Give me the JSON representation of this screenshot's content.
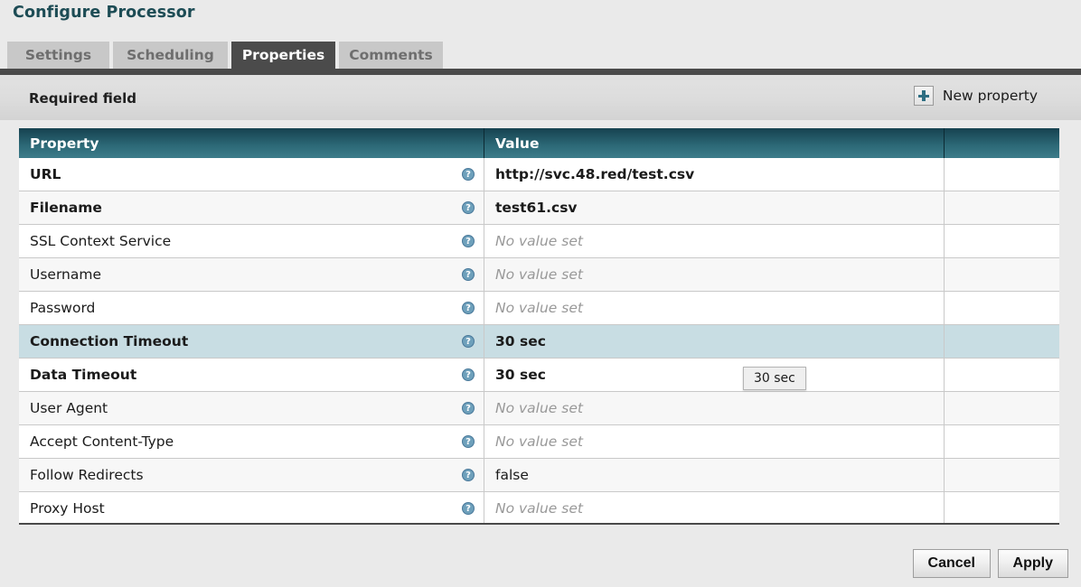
{
  "dialog": {
    "title": "Configure Processor"
  },
  "tabs": [
    {
      "label": "Settings",
      "active": false
    },
    {
      "label": "Scheduling",
      "active": false
    },
    {
      "label": "Properties",
      "active": true
    },
    {
      "label": "Comments",
      "active": false
    }
  ],
  "toolbar": {
    "required_legend": "Required field",
    "new_property_label": "New property",
    "new_property_icon": "plus-icon"
  },
  "table": {
    "columns": [
      "Property",
      "Value",
      ""
    ],
    "help_icon": "help-circle-icon",
    "no_value_placeholder": "No value set",
    "rows": [
      {
        "name": "URL",
        "value": "http://svc.48.red/test.csv",
        "required": true,
        "empty": false,
        "selected": false
      },
      {
        "name": "Filename",
        "value": "test61.csv",
        "required": true,
        "empty": false,
        "selected": false
      },
      {
        "name": "SSL Context Service",
        "value": "No value set",
        "required": false,
        "empty": true,
        "selected": false
      },
      {
        "name": "Username",
        "value": "No value set",
        "required": false,
        "empty": true,
        "selected": false
      },
      {
        "name": "Password",
        "value": "No value set",
        "required": false,
        "empty": true,
        "selected": false
      },
      {
        "name": "Connection Timeout",
        "value": "30 sec",
        "required": true,
        "empty": false,
        "selected": true
      },
      {
        "name": "Data Timeout",
        "value": "30 sec",
        "required": true,
        "empty": false,
        "selected": false
      },
      {
        "name": "User Agent",
        "value": "No value set",
        "required": false,
        "empty": true,
        "selected": false
      },
      {
        "name": "Accept Content-Type",
        "value": "No value set",
        "required": false,
        "empty": true,
        "selected": false
      },
      {
        "name": "Follow Redirects",
        "value": "false",
        "required": false,
        "empty": false,
        "selected": false
      },
      {
        "name": "Proxy Host",
        "value": "No value set",
        "required": false,
        "empty": true,
        "selected": false
      }
    ]
  },
  "tooltip": {
    "text": "30 sec"
  },
  "footer": {
    "cancel_label": "Cancel",
    "apply_label": "Apply"
  },
  "colors": {
    "title": "#1d4c55",
    "header_gradient_top": "#164250",
    "header_gradient_bottom": "#3d7c8a",
    "selected_row": "#c8dde3",
    "accent_plus": "#2e6e82",
    "active_tab": "#4b4b4b"
  }
}
